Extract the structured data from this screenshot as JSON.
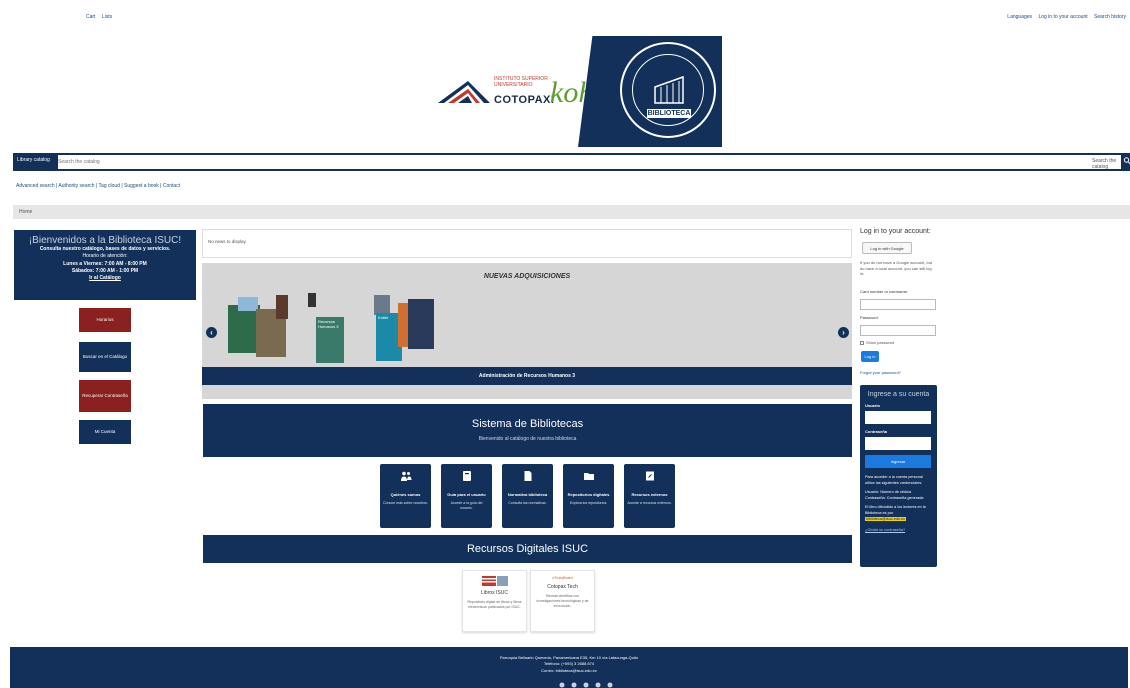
{
  "top": {
    "cart_label": "Cart",
    "lists_label": "Lists",
    "languages_label": "Languages",
    "login_link": "Log in to your account",
    "search_history_label": "Search history"
  },
  "banner": {
    "institute_line1": "INSTITUTO SUPERIOR",
    "institute_line2": "UNIVERSITARIO",
    "institute_name": "COTOPAXI",
    "koha_text": "koha",
    "seal_text": "BIBLIOTECA",
    "colors": {
      "navy": "#13305b",
      "red": "#c0392b",
      "koha_green": "#5a9e2f"
    }
  },
  "nav": {
    "label": "Library catalog",
    "search_placeholder": "Search the catalog",
    "search_button": "Search the catalog"
  },
  "links_row": "Advanced search | Authority search | Tag cloud | Suggest a book | Contact",
  "breadcrumb": "Home",
  "welcome": {
    "title": "¡Bienvenidos a la Biblioteca ISUC!",
    "line1": "Consulta nuestro catálogo, bases de datos y servicios.",
    "line2": "Horario de atención:",
    "line3": "Lunes a Viernes: 7:00 AM - 8:00 PM",
    "line4": "Sábados: 7:00 AM - 1:00 PM",
    "link": "Ir al Catálogo"
  },
  "side_buttons": {
    "b1": "Horarios",
    "b2": "Buscar en el Catálogo",
    "b3": "Recuperar Contraseña",
    "b4": "Mi Cuenta"
  },
  "news": {
    "text": "No news to display."
  },
  "carousel": {
    "title": "NUEVAS ADQUISICIONES",
    "book_text_1": "Recursos Humanos 3",
    "book_text_2": "Kotler",
    "caption": "Administración de Recursos Humanos 3",
    "prev": "‹",
    "next": "›"
  },
  "sistema": {
    "title": "Sistema de Bibliotecas",
    "subtitle": "Bienvenido al catálogo de nuestra biblioteca"
  },
  "cards": [
    {
      "title": "Quiénes somos",
      "desc": "Conoce más sobre nosotros."
    },
    {
      "title": "Guía para el usuario",
      "desc": "Accede a la guía del usuario."
    },
    {
      "title": "Normativa biblioteca",
      "desc": "Consulta las normativas."
    },
    {
      "title": "Repositorios digitales",
      "desc": "Explora los repositorios."
    },
    {
      "title": "Recursos externos",
      "desc": "Accede a recursos externos."
    }
  ],
  "recursos": {
    "title": "Recursos Digitales ISUC",
    "items": [
      {
        "title": "Libros ISUC",
        "desc": "Repositorio digital de libros y libros electrónicos publicados por ISUC."
      },
      {
        "logo_text": "eTrueqBoard",
        "title": "Cotopax Tech",
        "desc": "Revista científica con investigaciones tecnológicas y de innovación."
      }
    ]
  },
  "login": {
    "title": "Log in to your account:",
    "google": "Log in with Google",
    "note": "If you do not have a Google account, but do have a local account, you can still log in:",
    "card_label": "Card number or username:",
    "password_label": "Password:",
    "show_password": "Show password",
    "button": "Log in",
    "forgot": "Forgot your password?"
  },
  "ingrese": {
    "title": "Ingrese a su cuenta",
    "user_label": "Usuario",
    "password_label": "Contraseña",
    "button": "Ingresar",
    "p1": "Para acceder a la cuenta personal utilice las siguientes credenciales:",
    "p2": "Usuario: Número de cédula Contraseña: Contraseña generada",
    "p3": "El libro difundido a los lectores en la Biblioteca es por",
    "email": "biblioteca@isuc.edu.ec",
    "link": "¿Olvidó su contraseña?"
  },
  "footer": {
    "address": "Parroquia Belisario Quevedo, Panamericana E35, Km 10 vía Latacunga-Quito",
    "phone": "Teléfono: (+593) 3 2688 874",
    "email": "Correo: biblioteca@isuc.edu.ec"
  }
}
